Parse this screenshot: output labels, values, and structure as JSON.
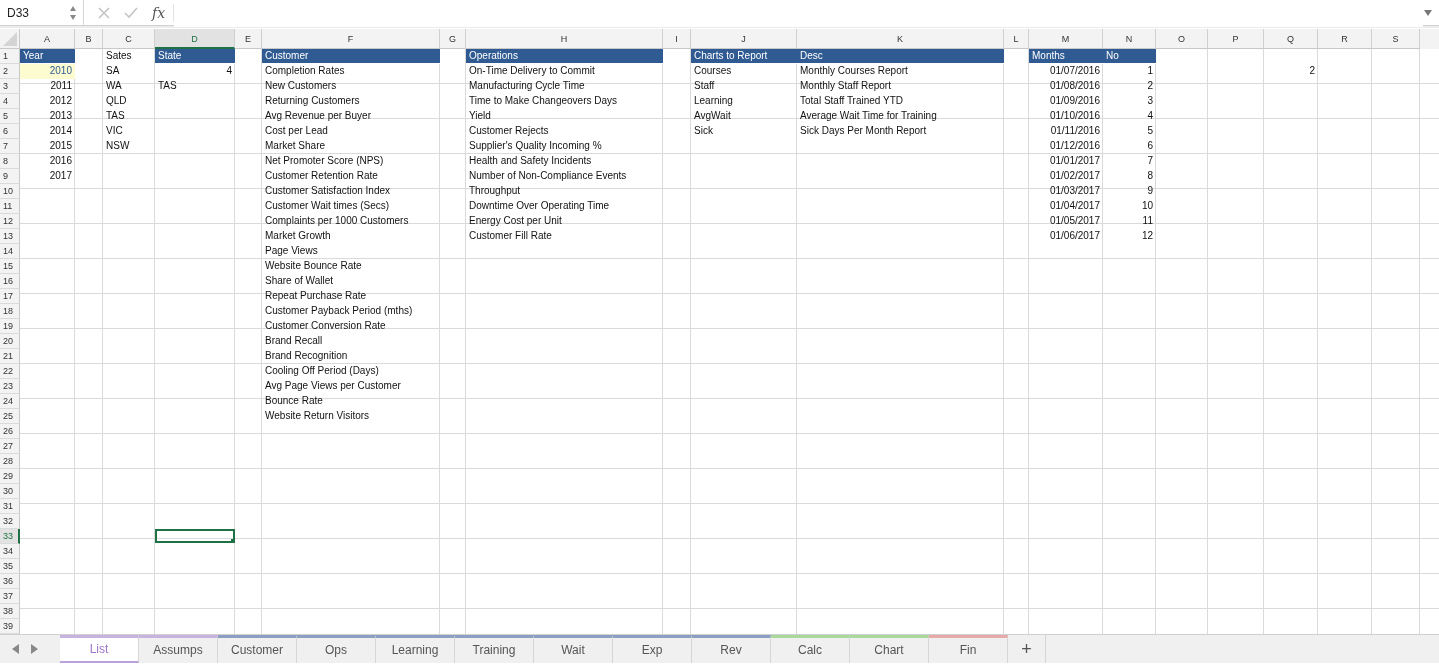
{
  "formula_bar": {
    "name_box": "D33",
    "fx_label": "fx"
  },
  "columns": [
    {
      "letter": "A",
      "selected": false,
      "heading": {
        "text": "Year",
        "kind": "band"
      },
      "cells": [
        {
          "text": "2010",
          "kind": "number",
          "highlighted": true
        },
        {
          "text": "2011",
          "kind": "number",
          "highlighted": false
        },
        {
          "text": "2012",
          "kind": "number",
          "highlighted": false
        },
        {
          "text": "2013",
          "kind": "number",
          "highlighted": false
        },
        {
          "text": "2014",
          "kind": "number",
          "highlighted": false
        },
        {
          "text": "2015",
          "kind": "number",
          "highlighted": false
        },
        {
          "text": "2016",
          "kind": "number",
          "highlighted": false
        },
        {
          "text": "2017",
          "kind": "number",
          "highlighted": false
        }
      ]
    },
    {
      "letter": "B",
      "selected": false
    },
    {
      "letter": "C",
      "selected": false,
      "heading": {
        "text": "Sates",
        "kind": "plain"
      },
      "cells": [
        {
          "text": "SA",
          "kind": "text"
        },
        {
          "text": "WA",
          "kind": "text"
        },
        {
          "text": "QLD",
          "kind": "text"
        },
        {
          "text": "TAS",
          "kind": "text"
        },
        {
          "text": "VIC",
          "kind": "text"
        },
        {
          "text": "NSW",
          "kind": "text"
        }
      ]
    },
    {
      "letter": "D",
      "selected": true,
      "heading": {
        "text": "State",
        "kind": "band"
      },
      "cells": [
        {
          "text": "4",
          "kind": "number"
        },
        {
          "text": "TAS",
          "kind": "text"
        }
      ]
    },
    {
      "letter": "E",
      "selected": false
    },
    {
      "letter": "F",
      "selected": false,
      "heading": {
        "text": "Customer",
        "kind": "band"
      },
      "cells": [
        {
          "text": "Completion Rates",
          "kind": "text"
        },
        {
          "text": "New Customers",
          "kind": "text"
        },
        {
          "text": "Returning Customers",
          "kind": "text"
        },
        {
          "text": "Avg Revenue per Buyer",
          "kind": "text"
        },
        {
          "text": "Cost per Lead",
          "kind": "text"
        },
        {
          "text": "Market Share",
          "kind": "text"
        },
        {
          "text": "Net Promoter Score (NPS)",
          "kind": "text"
        },
        {
          "text": "Customer Retention Rate",
          "kind": "text"
        },
        {
          "text": "Customer Satisfaction Index",
          "kind": "text"
        },
        {
          "text": "Customer Wait times (Secs)",
          "kind": "text"
        },
        {
          "text": "Complaints per 1000 Customers",
          "kind": "text"
        },
        {
          "text": "Market Growth",
          "kind": "text"
        },
        {
          "text": "Page Views",
          "kind": "text"
        },
        {
          "text": "Website Bounce Rate",
          "kind": "text"
        },
        {
          "text": "Share of Wallet",
          "kind": "text"
        },
        {
          "text": "Repeat Purchase Rate",
          "kind": "text"
        },
        {
          "text": "Customer Payback Period (mths)",
          "kind": "text"
        },
        {
          "text": "Customer Conversion Rate",
          "kind": "text"
        },
        {
          "text": "Brand Recall",
          "kind": "text"
        },
        {
          "text": "Brand Recognition",
          "kind": "text"
        },
        {
          "text": "Cooling Off Period (Days)",
          "kind": "text"
        },
        {
          "text": "Avg Page Views per Customer",
          "kind": "text"
        },
        {
          "text": "Bounce Rate",
          "kind": "text"
        },
        {
          "text": "Website Return Visitors",
          "kind": "text"
        }
      ]
    },
    {
      "letter": "G",
      "selected": false
    },
    {
      "letter": "H",
      "selected": false,
      "heading": {
        "text": "Operations",
        "kind": "band"
      },
      "cells": [
        {
          "text": "On-Time Delivery to Commit",
          "kind": "text"
        },
        {
          "text": "Manufacturing Cycle Time",
          "kind": "text"
        },
        {
          "text": "Time to Make Changeovers Days",
          "kind": "text"
        },
        {
          "text": "Yield",
          "kind": "text"
        },
        {
          "text": "Customer Rejects",
          "kind": "text"
        },
        {
          "text": "Supplier's Quality Incoming %",
          "kind": "text"
        },
        {
          "text": "Health and Safety Incidents",
          "kind": "text"
        },
        {
          "text": "Number of Non-Compliance Events",
          "kind": "text"
        },
        {
          "text": "Throughput",
          "kind": "text"
        },
        {
          "text": "Downtime Over Operating Time",
          "kind": "text"
        },
        {
          "text": "Energy Cost per Unit",
          "kind": "text"
        },
        {
          "text": "Customer Fill Rate",
          "kind": "text"
        }
      ]
    },
    {
      "letter": "I",
      "selected": false
    },
    {
      "letter": "J",
      "selected": false,
      "heading": {
        "text": "Charts to Report",
        "kind": "band"
      },
      "cells": [
        {
          "text": "Courses",
          "kind": "text"
        },
        {
          "text": "Staff",
          "kind": "text"
        },
        {
          "text": "Learning",
          "kind": "text"
        },
        {
          "text": "AvgWait",
          "kind": "text"
        },
        {
          "text": "Sick",
          "kind": "text"
        }
      ]
    },
    {
      "letter": "K",
      "selected": false,
      "heading": {
        "text": "Desc",
        "kind": "band"
      },
      "cells": [
        {
          "text": "Monthly Courses Report",
          "kind": "text"
        },
        {
          "text": "Monthly Staff Report",
          "kind": "text"
        },
        {
          "text": "Total Staff Trained YTD",
          "kind": "text"
        },
        {
          "text": "Average Wait Time for Training",
          "kind": "text"
        },
        {
          "text": "Sick Days Per Month Report",
          "kind": "text"
        }
      ]
    },
    {
      "letter": "L",
      "selected": false
    },
    {
      "letter": "M",
      "selected": false,
      "heading": {
        "text": "Months",
        "kind": "band"
      },
      "cells": [
        {
          "text": "01/07/2016",
          "kind": "number"
        },
        {
          "text": "01/08/2016",
          "kind": "number"
        },
        {
          "text": "01/09/2016",
          "kind": "number"
        },
        {
          "text": "01/10/2016",
          "kind": "number"
        },
        {
          "text": "01/11/2016",
          "kind": "number"
        },
        {
          "text": "01/12/2016",
          "kind": "number"
        },
        {
          "text": "01/01/2017",
          "kind": "number"
        },
        {
          "text": "01/02/2017",
          "kind": "number"
        },
        {
          "text": "01/03/2017",
          "kind": "number"
        },
        {
          "text": "01/04/2017",
          "kind": "number"
        },
        {
          "text": "01/05/2017",
          "kind": "number"
        },
        {
          "text": "01/06/2017",
          "kind": "number"
        }
      ]
    },
    {
      "letter": "N",
      "selected": false,
      "heading": {
        "text": "No",
        "kind": "band"
      },
      "cells": [
        {
          "text": "1",
          "kind": "number"
        },
        {
          "text": "2",
          "kind": "number"
        },
        {
          "text": "3",
          "kind": "number"
        },
        {
          "text": "4",
          "kind": "number"
        },
        {
          "text": "5",
          "kind": "number"
        },
        {
          "text": "6",
          "kind": "number"
        },
        {
          "text": "7",
          "kind": "number"
        },
        {
          "text": "8",
          "kind": "number"
        },
        {
          "text": "9",
          "kind": "number"
        },
        {
          "text": "10",
          "kind": "number"
        },
        {
          "text": "11",
          "kind": "number"
        },
        {
          "text": "12",
          "kind": "number"
        }
      ]
    },
    {
      "letter": "O",
      "selected": false
    },
    {
      "letter": "P",
      "selected": false
    },
    {
      "letter": "Q",
      "selected": false,
      "cells": [
        {
          "text": "2",
          "kind": "number"
        }
      ]
    },
    {
      "letter": "R",
      "selected": false
    },
    {
      "letter": "S",
      "selected": false
    }
  ],
  "rows": [
    {
      "number": "1",
      "selected": false
    },
    {
      "number": "2",
      "selected": false
    },
    {
      "number": "3",
      "selected": false
    },
    {
      "number": "4",
      "selected": false
    },
    {
      "number": "5",
      "selected": false
    },
    {
      "number": "6",
      "selected": false
    },
    {
      "number": "7",
      "selected": false
    },
    {
      "number": "8",
      "selected": false
    },
    {
      "number": "9",
      "selected": false
    },
    {
      "number": "10",
      "selected": false
    },
    {
      "number": "11",
      "selected": false
    },
    {
      "number": "12",
      "selected": false
    },
    {
      "number": "13",
      "selected": false
    },
    {
      "number": "14",
      "selected": false
    },
    {
      "number": "15",
      "selected": false
    },
    {
      "number": "16",
      "selected": false
    },
    {
      "number": "17",
      "selected": false
    },
    {
      "number": "18",
      "selected": false
    },
    {
      "number": "19",
      "selected": false
    },
    {
      "number": "20",
      "selected": false
    },
    {
      "number": "21",
      "selected": false
    },
    {
      "number": "22",
      "selected": false
    },
    {
      "number": "23",
      "selected": false
    },
    {
      "number": "24",
      "selected": false
    },
    {
      "number": "25",
      "selected": false
    },
    {
      "number": "26",
      "selected": false
    },
    {
      "number": "27",
      "selected": false
    },
    {
      "number": "28",
      "selected": false
    },
    {
      "number": "29",
      "selected": false
    },
    {
      "number": "30",
      "selected": false
    },
    {
      "number": "31",
      "selected": false
    },
    {
      "number": "32",
      "selected": false
    },
    {
      "number": "33",
      "selected": true
    },
    {
      "number": "34",
      "selected": false
    },
    {
      "number": "35",
      "selected": false
    },
    {
      "number": "36",
      "selected": false
    },
    {
      "number": "37",
      "selected": false
    },
    {
      "number": "38",
      "selected": false
    },
    {
      "number": "39",
      "selected": false
    }
  ],
  "tabs": [
    {
      "label": "List",
      "selected": true,
      "color": "#c6b3e0"
    },
    {
      "label": "Assumps",
      "selected": false,
      "color": "#c6b3e0"
    },
    {
      "label": "Customer",
      "selected": false,
      "color": "#8c9fc2"
    },
    {
      "label": "Ops",
      "selected": false,
      "color": "#8c9fc2"
    },
    {
      "label": "Learning",
      "selected": false,
      "color": "#8c9fc2"
    },
    {
      "label": "Training",
      "selected": false,
      "color": "#8c9fc2"
    },
    {
      "label": "Wait",
      "selected": false,
      "color": "#8c9fc2"
    },
    {
      "label": "Exp",
      "selected": false,
      "color": "#8c9fc2"
    },
    {
      "label": "Rev",
      "selected": false,
      "color": "#8c9fc2"
    },
    {
      "label": "Calc",
      "selected": false,
      "color": "#a9d99b"
    },
    {
      "label": "Chart",
      "selected": false,
      "color": "#a9d99b"
    },
    {
      "label": "Fin",
      "selected": false,
      "color": "#e8a9a9"
    }
  ],
  "add_sheet_label": "+"
}
